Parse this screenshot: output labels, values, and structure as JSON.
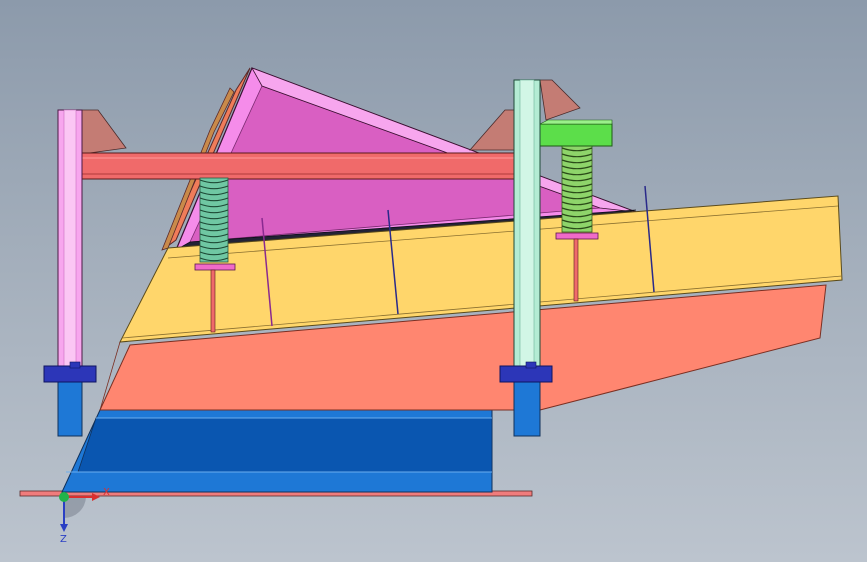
{
  "axis_labels": {
    "x": "X",
    "z": "Z"
  },
  "colors": {
    "background_top": "#8c9aab",
    "background_bottom": "#bcc4ce",
    "screen_box": "#ffd66b",
    "screen_box_side": "#ff8670",
    "hopper": "#d95fc2",
    "hopper_rim": "#f58cea",
    "hopper_side": "#f07c5a",
    "crossbeam": "#f06a6a",
    "post_left": "#f7a6ee",
    "post_right": "#b4ecd4",
    "green_block": "#5cde4a",
    "base_frame": "#1e78d6",
    "base_frame_dark": "#0a56b0",
    "clamp": "#2c36b8",
    "spring": "#6fc7a3",
    "bracket": "#c47c74",
    "base_plate": "#f07c7c",
    "axis_x": "#d93030",
    "axis_y": "#22b34a",
    "axis_z": "#2a3fc4"
  },
  "icons": {
    "triad": "coordinate-triad-icon"
  }
}
